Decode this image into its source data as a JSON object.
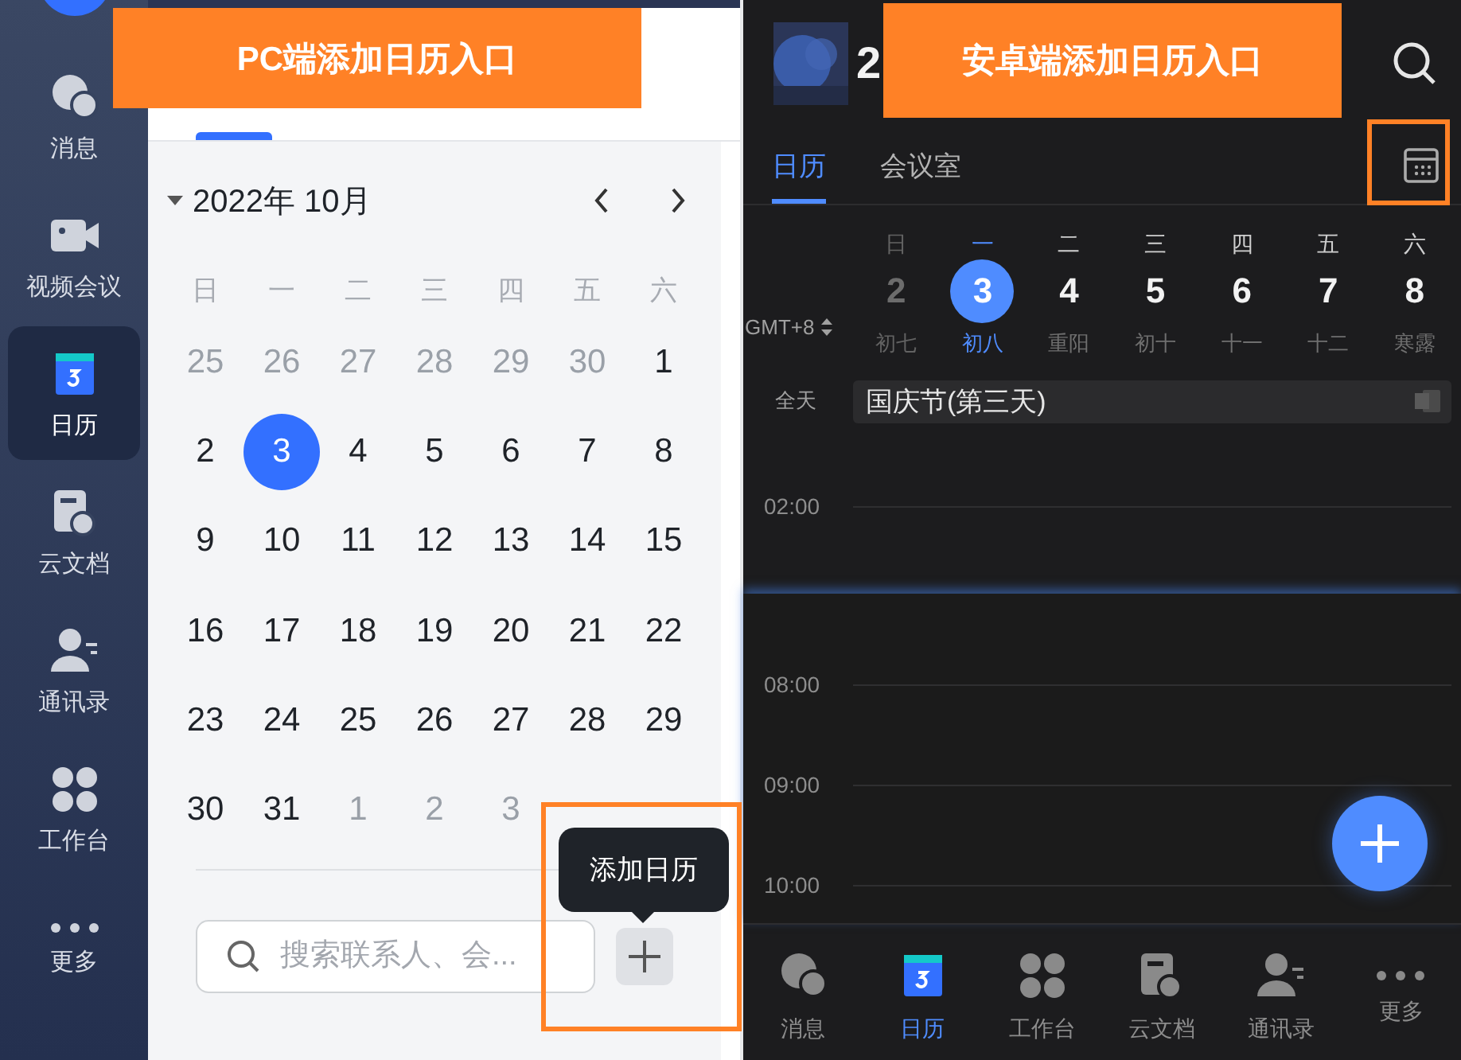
{
  "sidebar": {
    "items": [
      {
        "label": "消息",
        "kind": "chat",
        "selected": false
      },
      {
        "label": "视频会议",
        "kind": "video",
        "selected": false
      },
      {
        "label": "日历",
        "kind": "calendar",
        "selected": true
      },
      {
        "label": "云文档",
        "kind": "docs",
        "selected": false
      },
      {
        "label": "通讯录",
        "kind": "contacts",
        "selected": false
      },
      {
        "label": "工作台",
        "kind": "apps",
        "selected": false
      },
      {
        "label": "更多",
        "kind": "more",
        "selected": false
      }
    ]
  },
  "pc_calendar": {
    "month_label": "2022年 10月",
    "weekdays": [
      "日",
      "一",
      "二",
      "三",
      "四",
      "五",
      "六"
    ],
    "weeks": [
      [
        {
          "day": "25",
          "in_month": false,
          "selected": false
        },
        {
          "day": "26",
          "in_month": false,
          "selected": false
        },
        {
          "day": "27",
          "in_month": false,
          "selected": false
        },
        {
          "day": "28",
          "in_month": false,
          "selected": false
        },
        {
          "day": "29",
          "in_month": false,
          "selected": false
        },
        {
          "day": "30",
          "in_month": false,
          "selected": false
        },
        {
          "day": "1",
          "in_month": true,
          "selected": false
        }
      ],
      [
        {
          "day": "2",
          "in_month": true,
          "selected": false
        },
        {
          "day": "3",
          "in_month": true,
          "selected": true
        },
        {
          "day": "4",
          "in_month": true,
          "selected": false
        },
        {
          "day": "5",
          "in_month": true,
          "selected": false
        },
        {
          "day": "6",
          "in_month": true,
          "selected": false
        },
        {
          "day": "7",
          "in_month": true,
          "selected": false
        },
        {
          "day": "8",
          "in_month": true,
          "selected": false
        }
      ],
      [
        {
          "day": "9",
          "in_month": true,
          "selected": false
        },
        {
          "day": "10",
          "in_month": true,
          "selected": false
        },
        {
          "day": "11",
          "in_month": true,
          "selected": false
        },
        {
          "day": "12",
          "in_month": true,
          "selected": false
        },
        {
          "day": "13",
          "in_month": true,
          "selected": false
        },
        {
          "day": "14",
          "in_month": true,
          "selected": false
        },
        {
          "day": "15",
          "in_month": true,
          "selected": false
        }
      ],
      [
        {
          "day": "16",
          "in_month": true,
          "selected": false
        },
        {
          "day": "17",
          "in_month": true,
          "selected": false
        },
        {
          "day": "18",
          "in_month": true,
          "selected": false
        },
        {
          "day": "19",
          "in_month": true,
          "selected": false
        },
        {
          "day": "20",
          "in_month": true,
          "selected": false
        },
        {
          "day": "21",
          "in_month": true,
          "selected": false
        },
        {
          "day": "22",
          "in_month": true,
          "selected": false
        }
      ],
      [
        {
          "day": "23",
          "in_month": true,
          "selected": false
        },
        {
          "day": "24",
          "in_month": true,
          "selected": false
        },
        {
          "day": "25",
          "in_month": true,
          "selected": false
        },
        {
          "day": "26",
          "in_month": true,
          "selected": false
        },
        {
          "day": "27",
          "in_month": true,
          "selected": false
        },
        {
          "day": "28",
          "in_month": true,
          "selected": false
        },
        {
          "day": "29",
          "in_month": true,
          "selected": false
        }
      ],
      [
        {
          "day": "30",
          "in_month": true,
          "selected": false
        },
        {
          "day": "31",
          "in_month": true,
          "selected": false
        },
        {
          "day": "1",
          "in_month": false,
          "selected": false
        },
        {
          "day": "2",
          "in_month": false,
          "selected": false
        },
        {
          "day": "3",
          "in_month": false,
          "selected": false
        }
      ]
    ]
  },
  "search": {
    "placeholder": "搜索联系人、会..."
  },
  "tooltip": {
    "text": "添加日历"
  },
  "mobile": {
    "title": "2",
    "tabs": [
      {
        "label": "日历",
        "selected": true
      },
      {
        "label": "会议室",
        "selected": false
      }
    ],
    "week": [
      {
        "weekday": "日",
        "day": "2",
        "lunar": "初七",
        "selected": false,
        "past": true
      },
      {
        "weekday": "一",
        "day": "3",
        "lunar": "初八",
        "selected": true,
        "past": false
      },
      {
        "weekday": "二",
        "day": "4",
        "lunar": "重阳",
        "selected": false,
        "past": false
      },
      {
        "weekday": "三",
        "day": "5",
        "lunar": "初十",
        "selected": false,
        "past": false
      },
      {
        "weekday": "四",
        "day": "6",
        "lunar": "十一",
        "selected": false,
        "past": false
      },
      {
        "weekday": "五",
        "day": "7",
        "lunar": "十二",
        "selected": false,
        "past": false
      },
      {
        "weekday": "六",
        "day": "8",
        "lunar": "寒露",
        "selected": false,
        "past": false
      }
    ],
    "timezone": "GMT+8",
    "all_day_label": "全天",
    "all_day_event": "国庆节(第三天)",
    "upper_times": [
      "02:00"
    ],
    "lower_times": [
      "08:00",
      "09:00",
      "10:00"
    ],
    "nav": [
      {
        "label": "消息",
        "kind": "chat",
        "selected": false
      },
      {
        "label": "日历",
        "kind": "calendar",
        "selected": true
      },
      {
        "label": "工作台",
        "kind": "apps",
        "selected": false
      },
      {
        "label": "云文档",
        "kind": "docs",
        "selected": false
      },
      {
        "label": "通讯录",
        "kind": "contacts",
        "selected": false
      },
      {
        "label": "更多",
        "kind": "more",
        "selected": false
      }
    ]
  },
  "annotations": [
    {
      "text": "PC端添加日历入口"
    },
    {
      "text": "安卓端添加日历入口"
    }
  ]
}
